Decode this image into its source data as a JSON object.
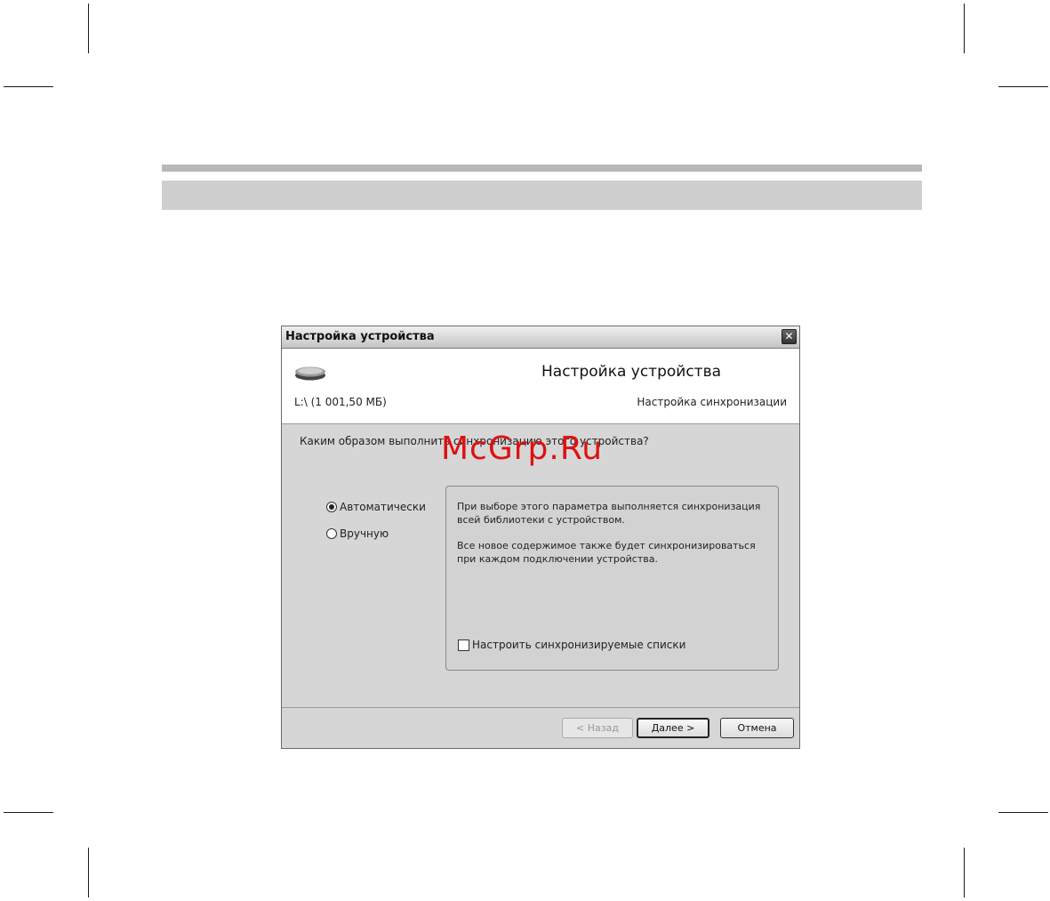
{
  "dialog": {
    "window_title": "Настройка устройства",
    "close_glyph": "✕",
    "header_title": "Настройка устройства",
    "drive_label": "L:\\ (1 001,50 МБ)",
    "step_label": "Настройка синхронизации",
    "question": "Каким образом выполнить синхронизацию этого устройства?",
    "options": [
      {
        "label": "Автоматически",
        "selected": true
      },
      {
        "label": "Вручную",
        "selected": false
      }
    ],
    "info_paragraph_1": "При выборе этого параметра выполняется синхронизация всей библиотеки с устройством.",
    "info_paragraph_2": "Все новое содержимое также будет синхронизироваться при каждом подключении устройства.",
    "checkbox_label": "Настроить синхронизируемые списки",
    "checkbox_checked": false,
    "buttons": {
      "back": "< Назад",
      "next": "Далее >",
      "cancel": "Отмена"
    },
    "icon": "portable-drive-icon"
  },
  "watermark": "McGrp.Ru"
}
